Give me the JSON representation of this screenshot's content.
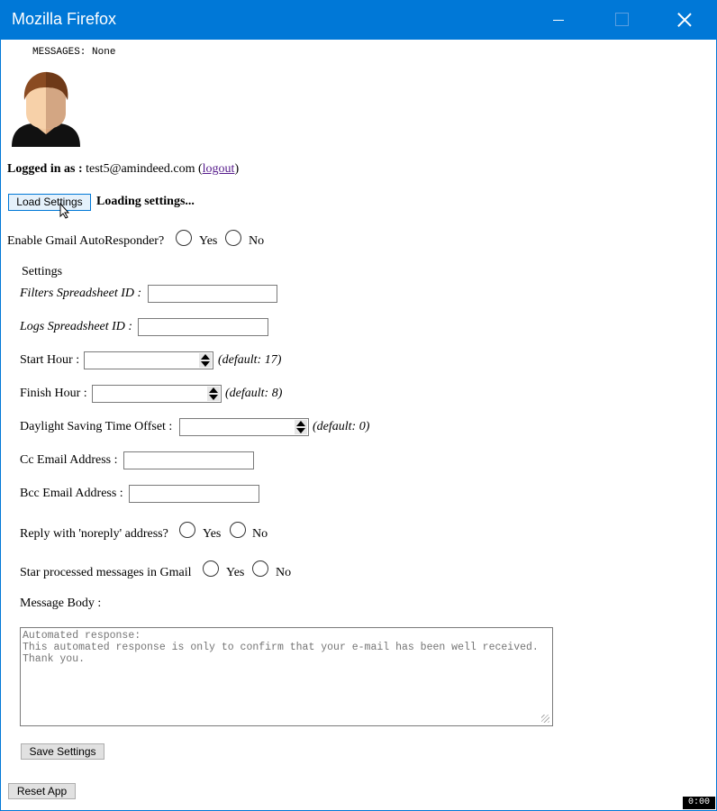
{
  "window": {
    "title": "Mozilla Firefox"
  },
  "messages": "MESSAGES: None",
  "login": {
    "label": "Logged in as :",
    "email": "test5@amindeed.com",
    "paren_open": "(",
    "logout": "logout",
    "paren_close": ")"
  },
  "load": {
    "button": "Load Settings",
    "status": "Loading settings..."
  },
  "autoresponder": {
    "question": "Enable Gmail AutoResponder?",
    "yes": "Yes",
    "no": "No"
  },
  "settings": {
    "heading": "Settings",
    "filters_label": "Filters Spreadsheet ID :",
    "logs_label": "Logs Spreadsheet ID :",
    "start_hour_label": "Start Hour :",
    "start_hour_default": "(default: 17)",
    "finish_hour_label": "Finish Hour :",
    "finish_hour_default": "(default: 8)",
    "dst_label": "Daylight Saving Time Offset :",
    "dst_default": "(default: 0)",
    "cc_label": "Cc Email Address :",
    "bcc_label": "Bcc Email Address :",
    "noreply_question": "Reply with 'noreply' address?",
    "star_question": "Star processed messages in Gmail",
    "yes": "Yes",
    "no": "No",
    "message_body_label": "Message Body :",
    "message_body_placeholder": "Automated response:\nThis automated response is only to confirm that your e-mail has been well received.\nThank you.",
    "save_button": "Save Settings"
  },
  "reset_button": "Reset App",
  "recording_timer": "0:00",
  "icons": {
    "avatar": "user-avatar-icon",
    "cursor": "mouse-pointer-icon"
  }
}
